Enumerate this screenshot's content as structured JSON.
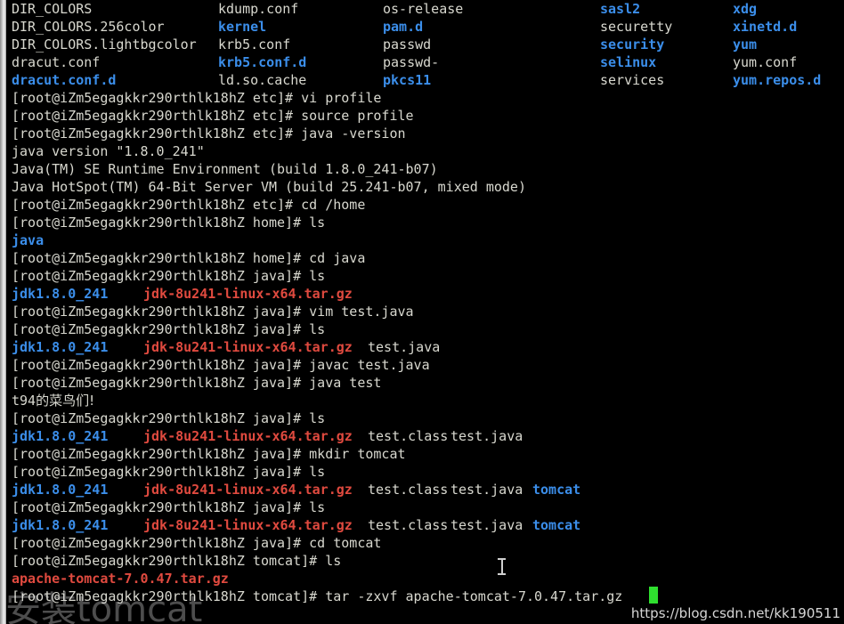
{
  "terminal": {
    "prompt_user_host": "[root@iZm5egagkkr290rthlk18hZ",
    "colors": {
      "background": "#000000",
      "foreground": "#d8d8cf",
      "directory_blue": "#3b8eea",
      "archive_red": "#e04a3f",
      "cursor_green": "#2fdf2f"
    },
    "ls_etc": {
      "rows": [
        [
          {
            "text": "DIR_COLORS",
            "color": "white"
          },
          {
            "text": "kdump.conf",
            "color": "white"
          },
          {
            "text": "os-release",
            "color": "white"
          },
          {
            "text": "sasl2",
            "color": "blue"
          },
          {
            "text": "xdg",
            "color": "blue"
          }
        ],
        [
          {
            "text": "DIR_COLORS.256color",
            "color": "white"
          },
          {
            "text": "kernel",
            "color": "blue"
          },
          {
            "text": "pam.d",
            "color": "blue"
          },
          {
            "text": "securetty",
            "color": "white"
          },
          {
            "text": "xinetd.d",
            "color": "blue"
          }
        ],
        [
          {
            "text": "DIR_COLORS.lightbgcolor",
            "color": "white"
          },
          {
            "text": "krb5.conf",
            "color": "white"
          },
          {
            "text": "passwd",
            "color": "white"
          },
          {
            "text": "security",
            "color": "blue"
          },
          {
            "text": "yum",
            "color": "blue"
          }
        ],
        [
          {
            "text": "dracut.conf",
            "color": "white"
          },
          {
            "text": "krb5.conf.d",
            "color": "blue"
          },
          {
            "text": "passwd-",
            "color": "white"
          },
          {
            "text": "selinux",
            "color": "blue"
          },
          {
            "text": "yum.conf",
            "color": "white"
          }
        ],
        [
          {
            "text": "dracut.conf.d",
            "color": "blue"
          },
          {
            "text": "ld.so.cache",
            "color": "white"
          },
          {
            "text": "pkcs11",
            "color": "blue"
          },
          {
            "text": "services",
            "color": "white"
          },
          {
            "text": "yum.repos.d",
            "color": "blue"
          }
        ]
      ]
    },
    "lines": [
      {
        "id": "cmd-vi-profile",
        "text": "[root@iZm5egagkkr290rthlk18hZ etc]# vi profile"
      },
      {
        "id": "cmd-source-profile",
        "text": "[root@iZm5egagkkr290rthlk18hZ etc]# source profile"
      },
      {
        "id": "cmd-java-version",
        "text": "[root@iZm5egagkkr290rthlk18hZ etc]# java -version"
      },
      {
        "id": "out-java-version",
        "text": "java version \"1.8.0_241\""
      },
      {
        "id": "out-java-runtime",
        "text": "Java(TM) SE Runtime Environment (build 1.8.0_241-b07)"
      },
      {
        "id": "out-java-hotspot",
        "text": "Java HotSpot(TM) 64-Bit Server VM (build 25.241-b07, mixed mode)"
      },
      {
        "id": "cmd-cd-home",
        "text": "[root@iZm5egagkkr290rthlk18hZ etc]# cd /home"
      },
      {
        "id": "cmd-ls-home",
        "text": "[root@iZm5egagkkr290rthlk18hZ home]# ls"
      },
      {
        "id": "out-ls-home",
        "text": "java",
        "color": "blue"
      },
      {
        "id": "cmd-cd-java",
        "text": "[root@iZm5egagkkr290rthlk18hZ home]# cd java"
      },
      {
        "id": "cmd-ls-java-1",
        "text": "[root@iZm5egagkkr290rthlk18hZ java]# ls"
      },
      {
        "id": "cmd-vim-test",
        "text": "[root@iZm5egagkkr290rthlk18hZ java]# vim test.java"
      },
      {
        "id": "cmd-ls-java-2",
        "text": "[root@iZm5egagkkr290rthlk18hZ java]# ls"
      },
      {
        "id": "cmd-javac-test",
        "text": "[root@iZm5egagkkr290rthlk18hZ java]# javac test.java"
      },
      {
        "id": "cmd-java-test",
        "text": "[root@iZm5egagkkr290rthlk18hZ java]# java test"
      },
      {
        "id": "out-java-test",
        "text": "t94的菜鸟们!"
      },
      {
        "id": "cmd-ls-java-3",
        "text": "[root@iZm5egagkkr290rthlk18hZ java]# ls"
      },
      {
        "id": "cmd-mkdir-tomcat",
        "text": "[root@iZm5egagkkr290rthlk18hZ java]# mkdir tomcat"
      },
      {
        "id": "cmd-ls-java-4",
        "text": "[root@iZm5egagkkr290rthlk18hZ java]# ls"
      },
      {
        "id": "cmd-ls-java-5",
        "text": "[root@iZm5egagkkr290rthlk18hZ java]# ls"
      },
      {
        "id": "cmd-cd-tomcat",
        "text": "[root@iZm5egagkkr290rthlk18hZ java]# cd tomcat"
      },
      {
        "id": "cmd-ls-tomcat",
        "text": "[root@iZm5egagkkr290rthlk18hZ tomcat]# ls"
      },
      {
        "id": "out-ls-tomcat",
        "text": "apache-tomcat-7.0.47.tar.gz",
        "color": "red"
      },
      {
        "id": "cmd-tar-extract",
        "text": "[root@iZm5egagkkr290rthlk18hZ tomcat]# tar -zxvf apache-tomcat-7.0.47.tar.gz"
      }
    ],
    "ls_java_outputs": {
      "row1": [
        {
          "text": "jdk1.8.0_241",
          "color": "blue"
        },
        {
          "text": "jdk-8u241-linux-x64.tar.gz",
          "color": "red"
        }
      ],
      "row2": [
        {
          "text": "jdk1.8.0_241",
          "color": "blue"
        },
        {
          "text": "jdk-8u241-linux-x64.tar.gz",
          "color": "red"
        },
        {
          "text": "test.java",
          "color": "white"
        }
      ],
      "row3": [
        {
          "text": "jdk1.8.0_241",
          "color": "blue"
        },
        {
          "text": "jdk-8u241-linux-x64.tar.gz",
          "color": "red"
        },
        {
          "text": "test.class",
          "color": "white"
        },
        {
          "text": "test.java",
          "color": "white"
        }
      ],
      "row4": [
        {
          "text": "jdk1.8.0_241",
          "color": "blue"
        },
        {
          "text": "jdk-8u241-linux-x64.tar.gz",
          "color": "red"
        },
        {
          "text": "test.class",
          "color": "white"
        },
        {
          "text": "test.java",
          "color": "white"
        },
        {
          "text": "tomcat",
          "color": "blue"
        }
      ],
      "row5": [
        {
          "text": "jdk1.8.0_241",
          "color": "blue"
        },
        {
          "text": "jdk-8u241-linux-x64.tar.gz",
          "color": "red"
        },
        {
          "text": "test.class",
          "color": "white"
        },
        {
          "text": "test.java",
          "color": "white"
        },
        {
          "text": "tomcat",
          "color": "blue"
        }
      ]
    },
    "overlay_caption": "安装tomcat",
    "watermark_url": "https://blog.csdn.net/kk190511"
  }
}
